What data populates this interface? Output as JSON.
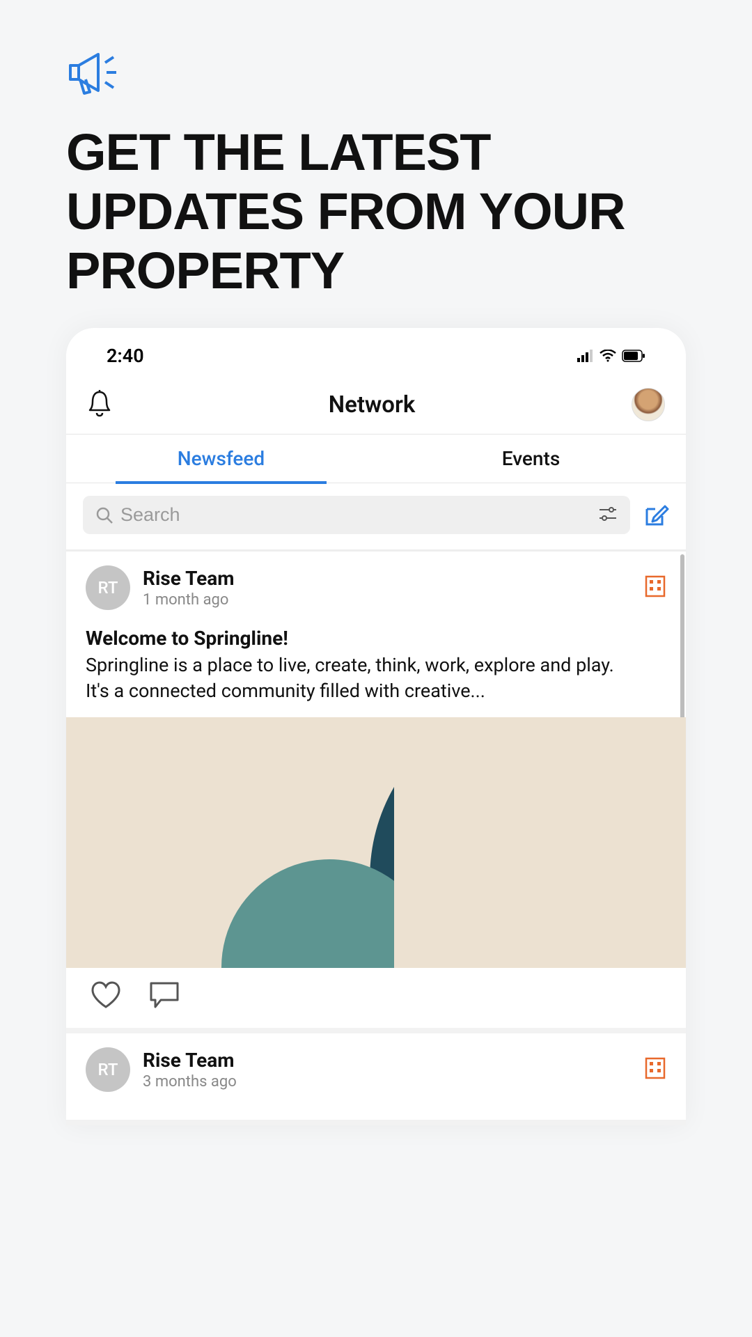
{
  "promo": {
    "title": "GET THE LATEST UPDATES FROM YOUR PROPERTY"
  },
  "status_bar": {
    "time": "2:40"
  },
  "header": {
    "title": "Network"
  },
  "tabs": [
    {
      "label": "Newsfeed",
      "active": true
    },
    {
      "label": "Events",
      "active": false
    }
  ],
  "search": {
    "placeholder": "Search"
  },
  "posts": [
    {
      "avatar_initials": "RT",
      "author": "Rise Team",
      "time_ago": "1 month ago",
      "title": "Welcome to Springline!",
      "body": "Springline is a place to live, create, think, work, explore and play.\nIt's a connected community filled with creative..."
    },
    {
      "avatar_initials": "RT",
      "author": "Rise Team",
      "time_ago": "3 months ago"
    }
  ],
  "colors": {
    "accent": "#2b7de0",
    "badge": "#e8692c"
  }
}
